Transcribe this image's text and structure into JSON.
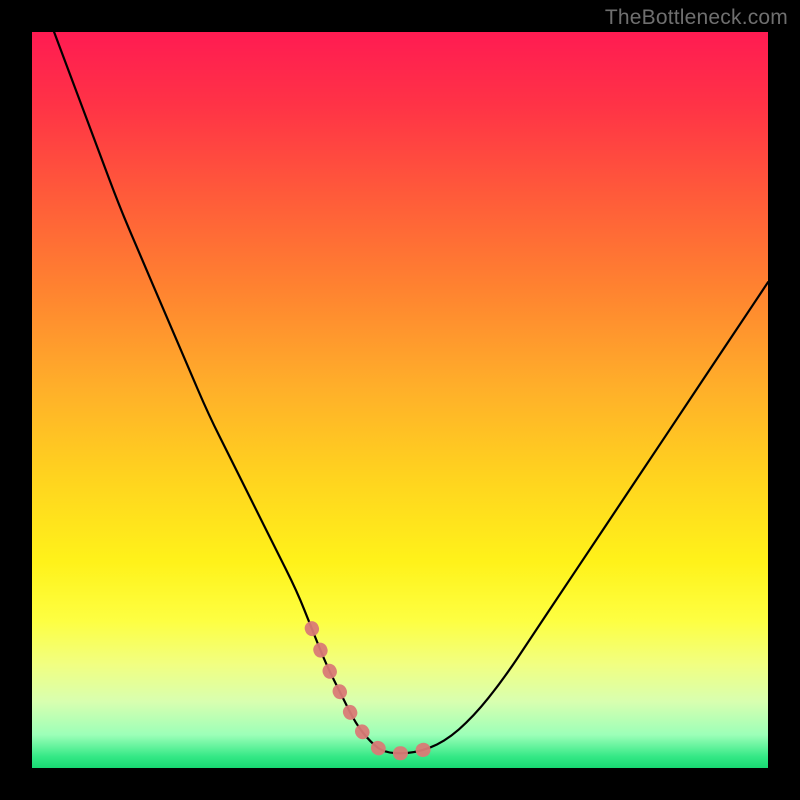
{
  "watermark": "TheBottleneck.com",
  "colors": {
    "highlight": "#d97a76",
    "curve": "#000000",
    "frame": "#000000"
  },
  "gradient_stops": [
    {
      "offset": 0.0,
      "color": "#ff1b52"
    },
    {
      "offset": 0.1,
      "color": "#ff3346"
    },
    {
      "offset": 0.22,
      "color": "#ff5a3a"
    },
    {
      "offset": 0.35,
      "color": "#ff8330"
    },
    {
      "offset": 0.48,
      "color": "#ffae2a"
    },
    {
      "offset": 0.6,
      "color": "#ffd21f"
    },
    {
      "offset": 0.72,
      "color": "#fff21a"
    },
    {
      "offset": 0.8,
      "color": "#fdff42"
    },
    {
      "offset": 0.86,
      "color": "#f1ff82"
    },
    {
      "offset": 0.91,
      "color": "#d8ffb0"
    },
    {
      "offset": 0.955,
      "color": "#9cffb8"
    },
    {
      "offset": 0.985,
      "color": "#33e885"
    },
    {
      "offset": 1.0,
      "color": "#18d872"
    }
  ],
  "chart_data": {
    "type": "line",
    "title": "",
    "xlabel": "",
    "ylabel": "",
    "xlim": [
      0,
      100
    ],
    "ylim": [
      0,
      100
    ],
    "grid": false,
    "legend": false,
    "series": [
      {
        "name": "bottleneck-curve",
        "x": [
          3,
          6,
          9,
          12,
          15,
          18,
          21,
          24,
          27,
          30,
          33,
          36,
          38,
          40,
          42,
          44,
          46,
          48,
          52,
          56,
          60,
          64,
          68,
          72,
          76,
          80,
          84,
          88,
          92,
          96,
          100
        ],
        "y": [
          100,
          92,
          84,
          76,
          69,
          62,
          55,
          48,
          42,
          36,
          30,
          24,
          19,
          14,
          10,
          6,
          3.5,
          2,
          2,
          3.5,
          7,
          12,
          18,
          24,
          30,
          36,
          42,
          48,
          54,
          60,
          66
        ]
      }
    ],
    "highlight_range_x": [
      38,
      56
    ]
  }
}
